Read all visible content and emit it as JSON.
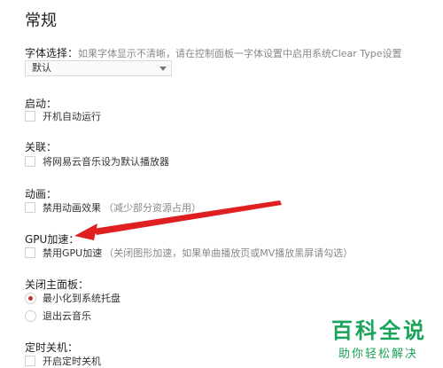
{
  "page_title": "常规",
  "font": {
    "label": "字体选择：",
    "hint": "如果字体显示不清晰，请在控制面板一字体设置中启用系统Clear Type设置",
    "selected": "默认"
  },
  "startup": {
    "title": "启动：",
    "option": "开机自动运行"
  },
  "association": {
    "title": "关联：",
    "option": "将网易云音乐设为默认播放器"
  },
  "animation": {
    "title": "动画：",
    "option": "禁用动画效果",
    "hint": "（减少部分资源占用）"
  },
  "gpu": {
    "title": "GPU加速：",
    "option": "禁用GPU加速",
    "hint": "（关闭图形加速，如果单曲播放页或MV播放黑屏请勾选）"
  },
  "close_panel": {
    "title": "关闭主面板：",
    "options": [
      {
        "label": "最小化到系统托盘",
        "selected": true
      },
      {
        "label": "退出云音乐",
        "selected": false
      }
    ]
  },
  "timer": {
    "title": "定时关机：",
    "option": "开启定时关机"
  },
  "watermark": {
    "main": "百科全说",
    "sub": "助你轻松解决",
    "color": "#1aa35a"
  },
  "colors": {
    "accent": "#c62f2f",
    "arrow": "#e02020"
  }
}
